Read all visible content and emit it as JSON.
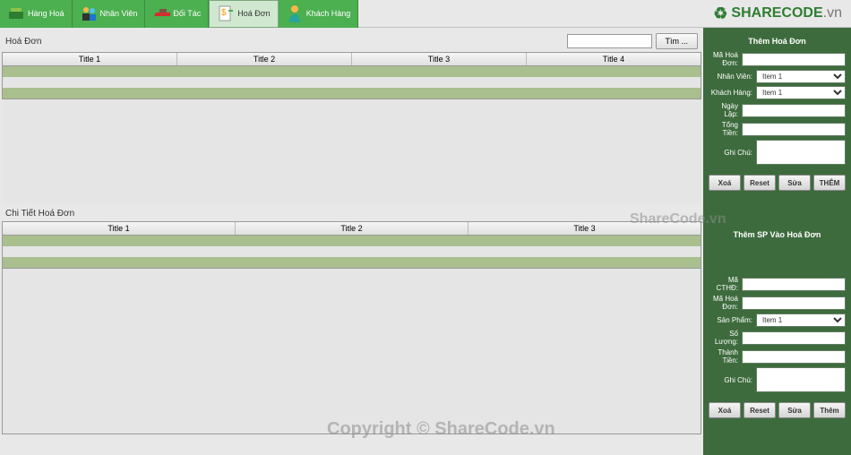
{
  "menu": {
    "items": [
      {
        "label": "Hàng Hoá"
      },
      {
        "label": "Nhân Viên"
      },
      {
        "label": "Đối Tác"
      },
      {
        "label": "Hoá Đơn"
      },
      {
        "label": "Khách Hàng"
      }
    ]
  },
  "logo": {
    "brand1": "SHARE",
    "brand2": "CODE",
    "suffix": ".vn"
  },
  "invoice": {
    "title": "Hoá Đơn",
    "searchBtn": "Tìm ...",
    "columns": [
      "Title 1",
      "Title 2",
      "Title 3",
      "Title 4"
    ]
  },
  "detail": {
    "title": "Chi Tiết Hoá Đơn",
    "columns": [
      "Title 1",
      "Title 2",
      "Title 3"
    ]
  },
  "formA": {
    "title": "Thêm Hoá Đơn",
    "fields": {
      "maHD": {
        "label": "Mã Hoá Đơn:",
        "value": ""
      },
      "nhanVien": {
        "label": "Nhân Viên:",
        "value": "Item 1"
      },
      "khachHang": {
        "label": "Khách Hàng:",
        "value": "Item 1"
      },
      "ngayLap": {
        "label": "Ngày Lập:",
        "value": ""
      },
      "tongTien": {
        "label": "Tổng Tiền:",
        "value": ""
      },
      "ghiChu": {
        "label": "Ghi Chú:",
        "value": ""
      }
    },
    "buttons": {
      "xoa": "Xoá",
      "reset": "Reset",
      "sua": "Sửa",
      "them": "THÊM"
    }
  },
  "formB": {
    "title": "Thêm SP Vào Hoá Đơn",
    "fields": {
      "maCTHD": {
        "label": "Mã CTHĐ:",
        "value": ""
      },
      "maHD": {
        "label": "Mã Hoá Đơn:",
        "value": ""
      },
      "sanPham": {
        "label": "Sản Phẩm:",
        "value": "Item 1"
      },
      "soLuong": {
        "label": "Số Lượng:",
        "value": ""
      },
      "thanhTien": {
        "label": "Thành Tiền:",
        "value": ""
      },
      "ghiChu": {
        "label": "Ghi Chú:",
        "value": ""
      }
    },
    "buttons": {
      "xoa": "Xoá",
      "reset": "Reset",
      "sua": "Sửa",
      "them": "Thêm"
    }
  },
  "watermark": {
    "main": "Copyright © ShareCode.vn",
    "side": "ShareCode.vn"
  }
}
